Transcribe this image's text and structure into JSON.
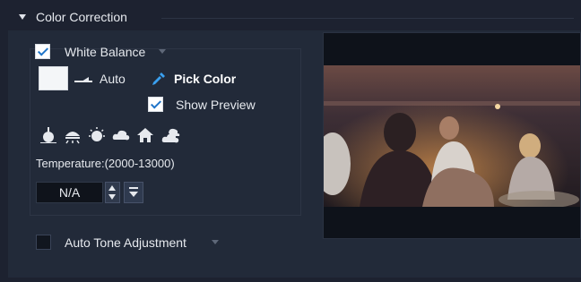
{
  "section": {
    "title": "Color Correction"
  },
  "white_balance": {
    "label": "White Balance",
    "checked": true,
    "auto_label": "Auto",
    "pick_color_label": "Pick Color",
    "show_preview_label": "Show Preview",
    "show_preview_checked": true,
    "presets": [
      "tungsten-light-icon",
      "fluorescent-light-icon",
      "daylight-icon",
      "cloudy-icon",
      "shade-icon",
      "overcast-icon"
    ],
    "temperature_label": "Temperature:(2000-13000)",
    "temperature_value": "N/A"
  },
  "auto_tone": {
    "label": "Auto Tone Adjustment",
    "checked": false
  },
  "colors": {
    "background": "#1d2230",
    "panel": "#222a39",
    "accent": "#1f74c8"
  }
}
